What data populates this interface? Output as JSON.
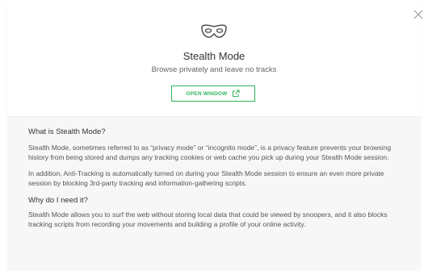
{
  "header": {
    "title": "Stealth Mode",
    "subtitle": "Browse privately and leave no tracks",
    "open_window_label": "OPEN WINDOW",
    "mask_icon": "mask-icon",
    "close_icon": "close-icon",
    "external_link_icon": "external-link-icon"
  },
  "info": {
    "q1": "What is Stealth Mode?",
    "p1": "Stealth Mode, sometimes referred to as “privacy mode” or “incognito mode”, is a privacy feature prevents your browsing history from being stored and dumps any tracking cookies or web cache you pick up during your Stealth Mode session.",
    "p2": "In addition, Anti-Tracking is automatically turned on during your Stealth Mode session to ensure an even more private session by blocking 3rd-party tracking and information-gathering scripts.",
    "q2": "Why do I need it?",
    "p3": "Stealth Mode allows you to surf the web without storing local data that could be viewed by snoopers, and it also blocks tracking scripts from recording your movements and building a profile of your online activity."
  },
  "colors": {
    "accent": "#2fb45a",
    "background_light": "#f7f7f7"
  }
}
